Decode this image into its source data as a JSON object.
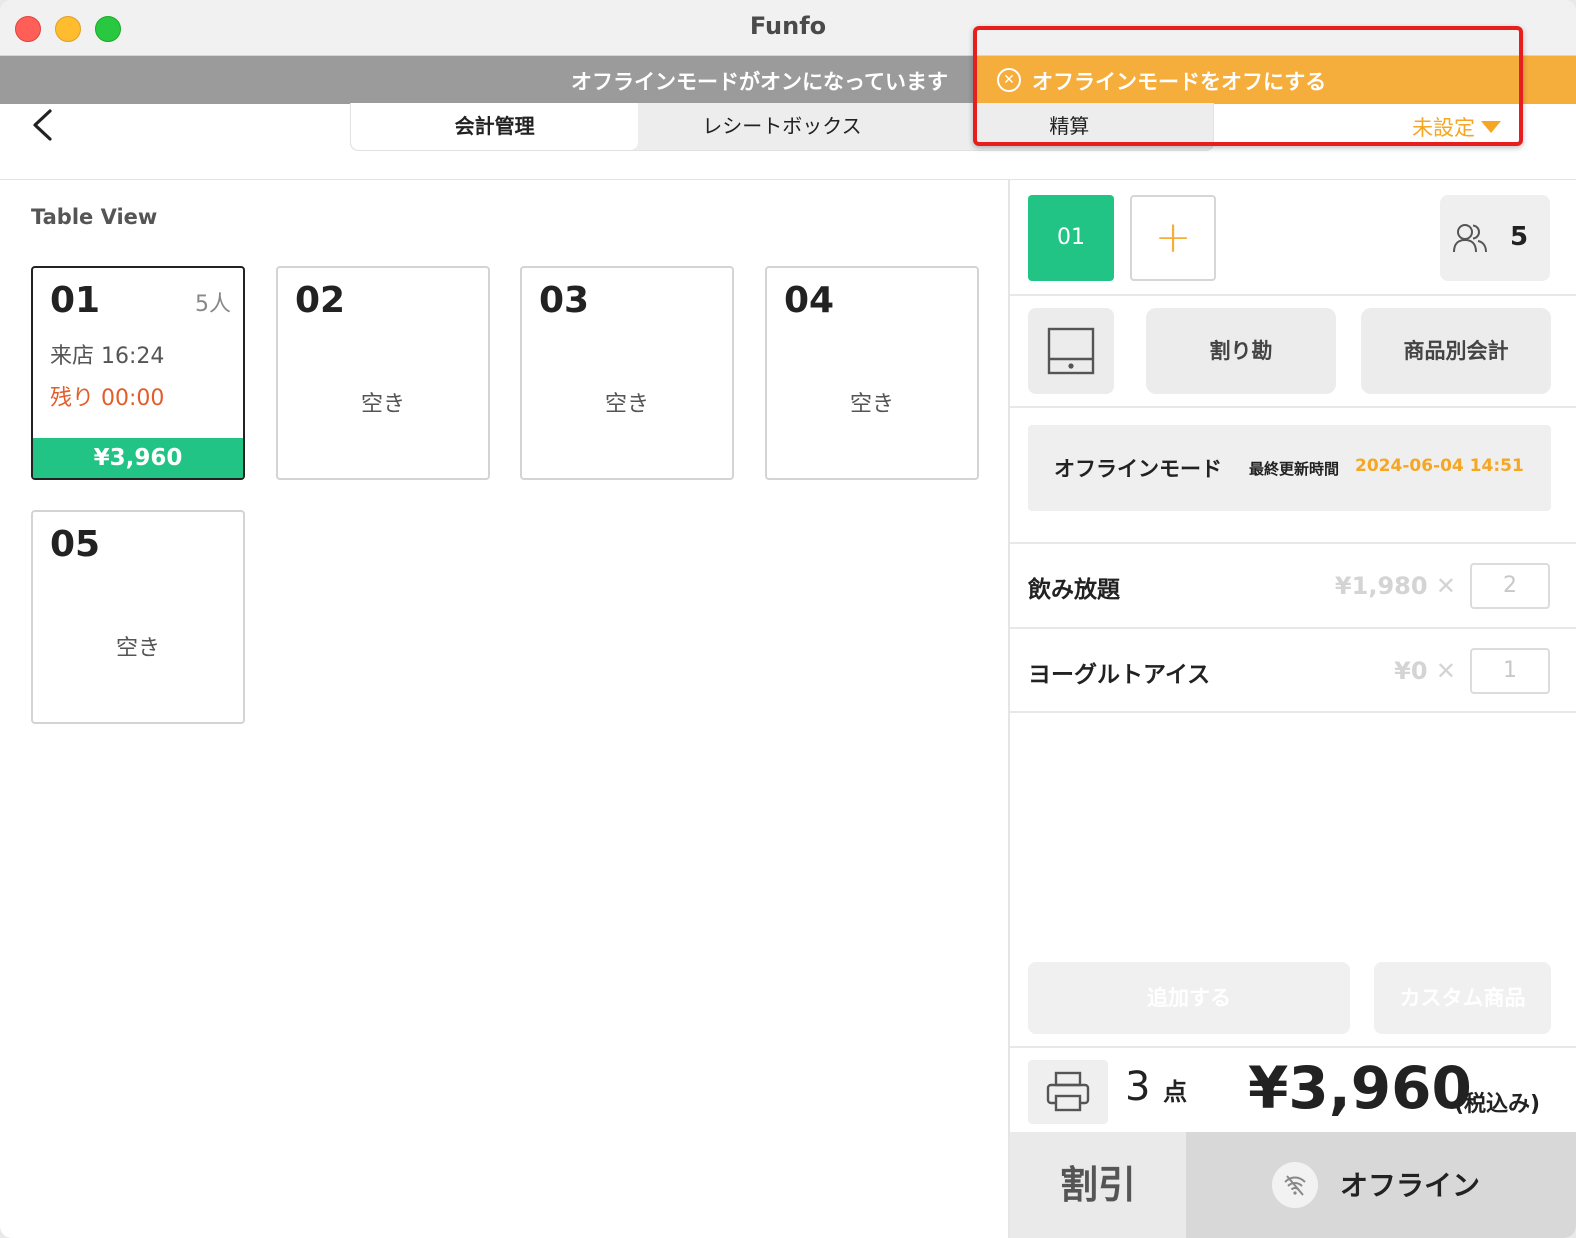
{
  "window": {
    "title": "Funfo"
  },
  "banner": {
    "message": "オフラインモードがオンになっています",
    "turn_off": "オフラインモードをオフにする"
  },
  "nav": {
    "tabs": [
      {
        "label": "会計管理",
        "active": true
      },
      {
        "label": "レシートボックス",
        "active": false
      },
      {
        "label": "精算",
        "active": false
      }
    ],
    "dropdown": "未設定"
  },
  "table_view": {
    "title": "Table View",
    "tables": [
      {
        "number": "01",
        "people": "5人",
        "arrival": "来店 16:24",
        "remaining": "残り 00:00",
        "amount": "¥3,960"
      },
      {
        "number": "02",
        "status": "空き"
      },
      {
        "number": "03",
        "status": "空き"
      },
      {
        "number": "04",
        "status": "空き"
      },
      {
        "number": "05",
        "status": "空き"
      }
    ]
  },
  "order": {
    "selected_table": "01",
    "add_symbol": "+",
    "guests": "5",
    "split_label": "割り勘",
    "item_checkout_label": "商品別会計",
    "offline_mode_label": "オフラインモード",
    "last_updated_label": "最終更新時間",
    "last_updated_value": "2024-06-04 14:51",
    "items": [
      {
        "name": "飲み放題",
        "price": "¥1,980 ✕",
        "qty": "2"
      },
      {
        "name": "ヨーグルトアイス",
        "price": "¥0 ✕",
        "qty": "1"
      }
    ],
    "add_button": "追加する",
    "custom_button": "カスタム商品",
    "count": "3",
    "count_unit": "点",
    "total": "¥3,960",
    "tax_note": "(税込み)",
    "discount_label": "割引",
    "offline_label": "オフライン"
  },
  "colors": {
    "accent_green": "#21c485",
    "accent_orange": "#f5ad3c",
    "remaining_red": "#e35d2b",
    "highlight_red": "#e81d1d"
  }
}
